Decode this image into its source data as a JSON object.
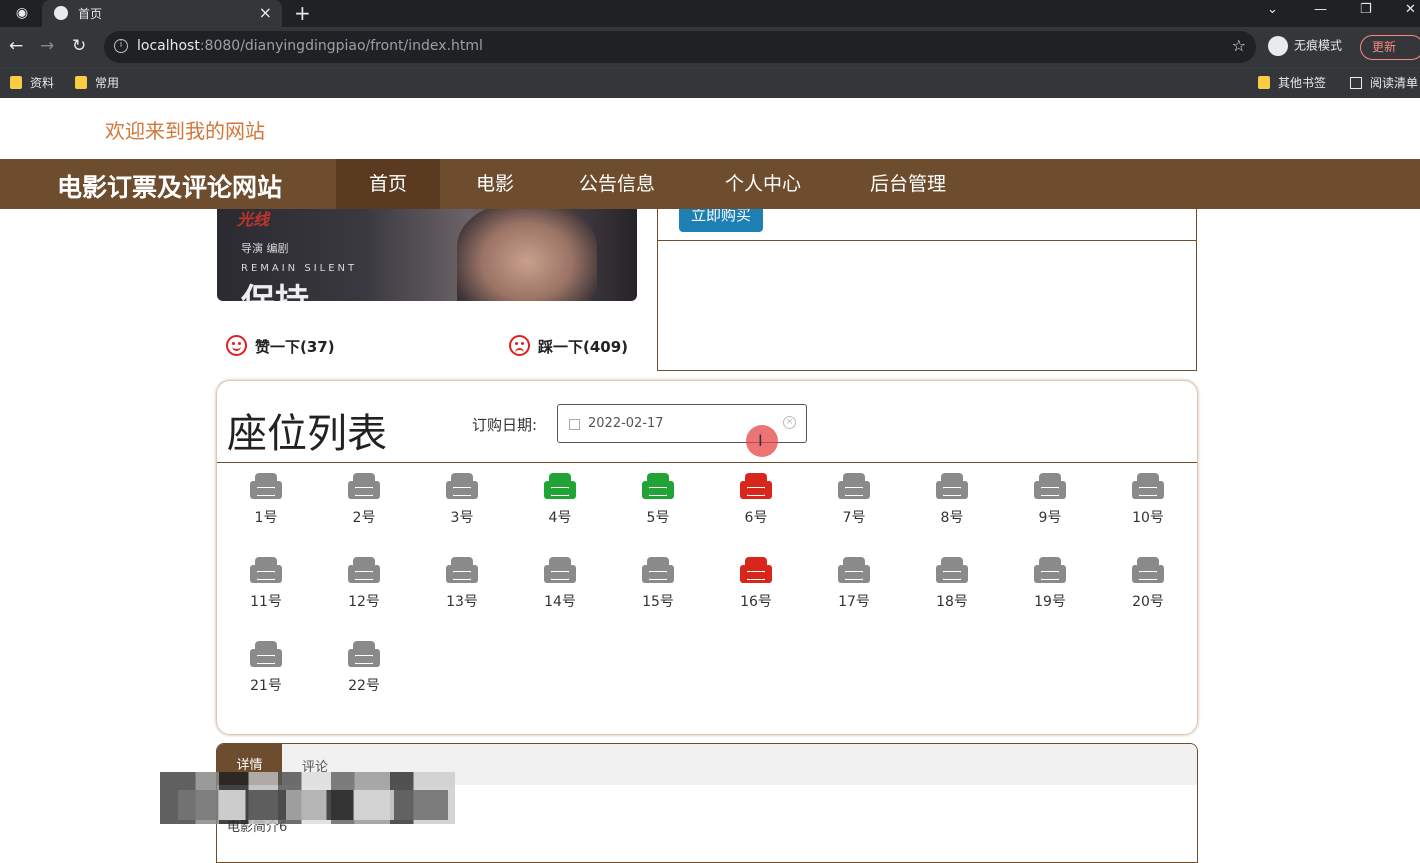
{
  "browser": {
    "tab_title": "首页",
    "url_host": "localhost",
    "url_rest": ":8080/dianyingdingpiao/front/index.html",
    "incognito_label": "无痕模式",
    "update_label": "更新",
    "bookmarks": [
      "资料",
      "常用"
    ],
    "bookmarks_right": [
      "其他书签",
      "阅读清单"
    ]
  },
  "site": {
    "welcome": "欢迎来到我的网站",
    "brand": "电影订票及评论网站",
    "nav": [
      "首页",
      "电影",
      "公告信息",
      "个人中心",
      "后台管理"
    ],
    "nav_active": "首页",
    "buy_label": "立即购买",
    "like_label": "赞一下(37)",
    "dislike_label": "踩一下(409)"
  },
  "seats_section": {
    "title": "座位列表",
    "date_label": "订购日期:",
    "date_value": "2022-02-17",
    "colors": {
      "available": "#8a8a8a",
      "selected": "#21a336",
      "sold": "#d9261c"
    },
    "seats": [
      {
        "label": "1号",
        "status": "available"
      },
      {
        "label": "2号",
        "status": "available"
      },
      {
        "label": "3号",
        "status": "available"
      },
      {
        "label": "4号",
        "status": "selected"
      },
      {
        "label": "5号",
        "status": "selected"
      },
      {
        "label": "6号",
        "status": "sold"
      },
      {
        "label": "7号",
        "status": "available"
      },
      {
        "label": "8号",
        "status": "available"
      },
      {
        "label": "9号",
        "status": "available"
      },
      {
        "label": "10号",
        "status": "available"
      },
      {
        "label": "11号",
        "status": "available"
      },
      {
        "label": "12号",
        "status": "available"
      },
      {
        "label": "13号",
        "status": "available"
      },
      {
        "label": "14号",
        "status": "available"
      },
      {
        "label": "15号",
        "status": "available"
      },
      {
        "label": "16号",
        "status": "sold"
      },
      {
        "label": "17号",
        "status": "available"
      },
      {
        "label": "18号",
        "status": "available"
      },
      {
        "label": "19号",
        "status": "available"
      },
      {
        "label": "20号",
        "status": "available"
      },
      {
        "label": "21号",
        "status": "available"
      },
      {
        "label": "22号",
        "status": "available"
      }
    ]
  },
  "detail": {
    "tabs": [
      "详情",
      "评论"
    ],
    "intro_text": "电影简介6"
  }
}
